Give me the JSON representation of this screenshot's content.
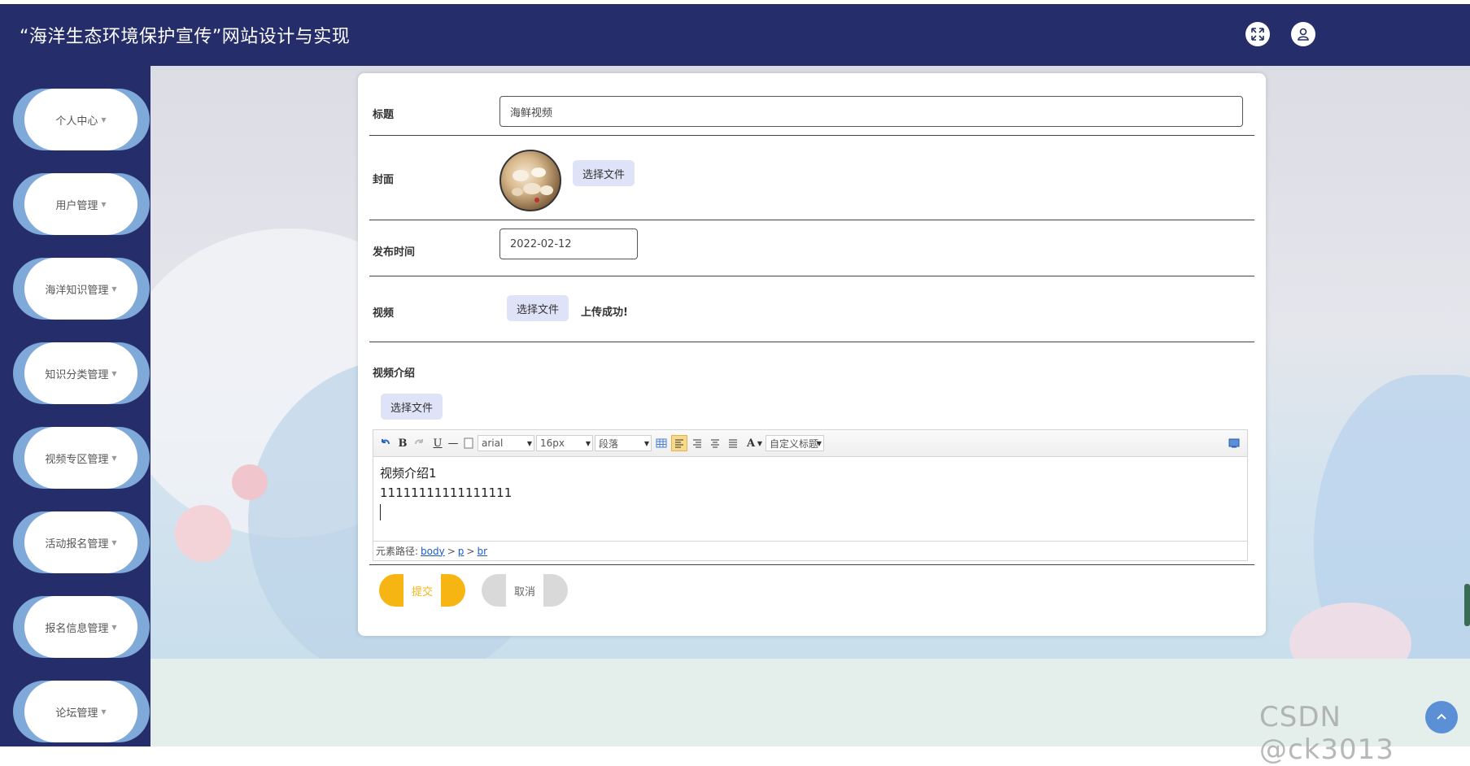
{
  "header": {
    "title": "“海洋生态环境保护宣传”网站设计与实现",
    "icons": [
      "fullscreen-icon",
      "user-icon"
    ]
  },
  "sidebar": {
    "items": [
      {
        "label": "个人中心"
      },
      {
        "label": "用户管理"
      },
      {
        "label": "海洋知识管理"
      },
      {
        "label": "知识分类管理"
      },
      {
        "label": "视频专区管理"
      },
      {
        "label": "活动报名管理"
      },
      {
        "label": "报名信息管理"
      },
      {
        "label": "论坛管理"
      }
    ],
    "caret": "▼"
  },
  "form": {
    "title_label": "标题",
    "title_value": "海鲜视频",
    "cover_label": "封面",
    "cover_button": "选择文件",
    "publish_label": "发布时间",
    "publish_value": "2022-02-12",
    "video_label": "视频",
    "video_button": "选择文件",
    "video_status": "上传成功!",
    "intro_label": "视频介绍",
    "intro_button": "选择文件",
    "submit_label": "提交",
    "cancel_label": "取消"
  },
  "editor": {
    "toolbar": {
      "bold": "B",
      "underline": "U",
      "hr": "—",
      "font_family": "arial",
      "font_size": "16px",
      "paragraph": "段落",
      "font_color": "A",
      "custom_title": "自定义标题"
    },
    "content_lines": [
      "视频介绍1",
      "11111111111111111"
    ],
    "path_label": "元素路径:",
    "path": [
      "body",
      "p",
      "br"
    ],
    "path_sep": ">"
  },
  "watermark": "CSDN @ck3013",
  "colors": {
    "header_bg": "#262d6b",
    "menu_accent": "#7fa9d8",
    "submit": "#f7b514",
    "file_button": "#dfe3f8"
  }
}
